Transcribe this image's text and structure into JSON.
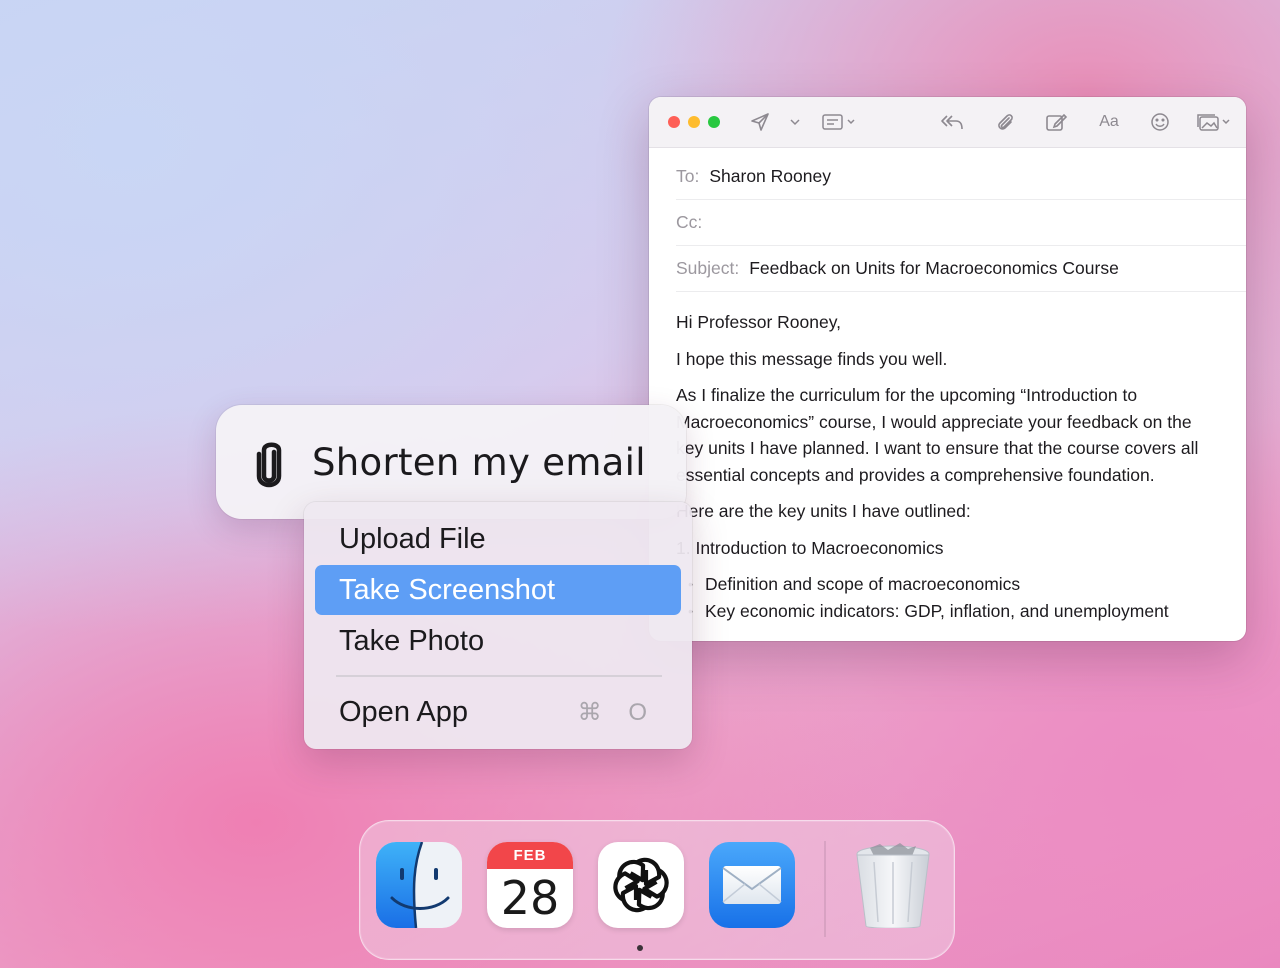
{
  "mail": {
    "to_label": "To:",
    "to_value": "Sharon Rooney",
    "cc_label": "Cc:",
    "cc_value": "",
    "subject_label": "Subject:",
    "subject_value": "Feedback on Units for Macroeconomics Course",
    "toolbar": {
      "font_label": "Aa"
    },
    "body": {
      "greeting": "Hi Professor Rooney,",
      "p1": "I hope this message finds you well.",
      "p2": "As I finalize the curriculum for the upcoming “Introduction to Macroeconomics” course, I would appreciate your feedback on the key units I have planned. I want to ensure that the course covers all essential concepts and provides a comprehensive foundation.",
      "p3": "Here are the key units I have outlined:",
      "unit1_title": "1. Introduction to Macroeconomics",
      "unit1_bullets": [
        "Definition and scope of macroeconomics",
        "Key economic indicators: GDP, inflation, and unemployment"
      ]
    }
  },
  "prompt": {
    "text": "Shorten my email",
    "icon": "paperclip-icon"
  },
  "menu": {
    "items": [
      {
        "label": "Upload File",
        "selected": false
      },
      {
        "label": "Take Screenshot",
        "selected": true
      },
      {
        "label": "Take Photo",
        "selected": false
      },
      {
        "label": "Open App",
        "selected": false,
        "shortcut": "⌘ O"
      }
    ]
  },
  "dock": {
    "apps": [
      {
        "name": "Finder",
        "icon": "finder-icon"
      },
      {
        "name": "Calendar",
        "icon": "calendar-icon",
        "month": "FEB",
        "day": "28"
      },
      {
        "name": "ChatGPT",
        "icon": "chatgpt-icon",
        "running": true
      },
      {
        "name": "Mail",
        "icon": "mail-icon"
      },
      {
        "name": "Trash",
        "icon": "trash-icon"
      }
    ]
  },
  "colors": {
    "selection": "#5e9ef5",
    "calendar_red": "#f2464a",
    "traffic_red": "#fe5f57",
    "traffic_yellow": "#febc2e",
    "traffic_green": "#28c840"
  }
}
